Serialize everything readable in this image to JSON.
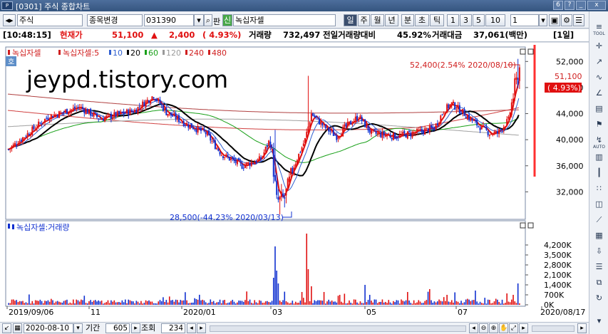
{
  "window": {
    "title": "[0301] 주식 종합차트",
    "btn_num": "6",
    "btn_q": "?",
    "btn_min": "_",
    "btn_close": "x"
  },
  "toolbar": {
    "market": "주식",
    "stock_change": "종목변경",
    "code": "031390",
    "pan": "판",
    "shin": "신",
    "stock_name": "녹십자셀",
    "period_buttons": [
      "일",
      "주",
      "월",
      "년",
      "분",
      "초",
      "틱"
    ],
    "active_period": "일",
    "interval_buttons": [
      "1",
      "3",
      "5",
      "10"
    ],
    "interval_value": "1"
  },
  "info": {
    "time": "[10:48:15]",
    "price_label": "현재가",
    "price": "51,100",
    "change_arrow": "▲",
    "change": "2,400",
    "change_pct": "( 4.93%)",
    "volume_label": "거래량",
    "volume": "732,497",
    "prev_ratio_label": "전일거래량대비",
    "prev_ratio": "45.92%",
    "amount_label": "거래대금",
    "amount": "37,061(백만)",
    "period": "[1일]"
  },
  "chart": {
    "legend_main": {
      "name": "녹십자셀",
      "ma_name": "녹십자셀:5",
      "ma": [
        {
          "label": "10",
          "color": "#2f5fd0"
        },
        {
          "label": "20",
          "color": "#000000"
        },
        {
          "label": "60",
          "color": "#18a018"
        },
        {
          "label": "120",
          "color": "#9a9a9a"
        },
        {
          "label": "240",
          "color": "#d02020"
        },
        {
          "label": "480",
          "color": "#d02020"
        }
      ]
    },
    "legend_volume": "녹십자셀:거래량",
    "watermark": "jeypd.tistory.com",
    "badge": "호",
    "annotations": {
      "high": "52,400(2.54% 2020/08/10)",
      "low": "28,500(-44.23% 2020/03/13)"
    },
    "price_axis": [
      "52,000",
      "48,000",
      "44,000",
      "40,000",
      "36,000",
      "32,000"
    ],
    "current_price_tag": {
      "price": "51,100",
      "pct": "( 4.93%)"
    },
    "volume_axis": [
      "4,200K",
      "3,500K",
      "2,800K",
      "2,100K",
      "1,400K",
      "700K",
      "0K"
    ],
    "date_axis": [
      "2019/09/06",
      "11",
      "2020/01",
      "03",
      "05",
      "07",
      "2020/08/17"
    ],
    "colors": {
      "up": "#e01010",
      "down": "#1030d0",
      "ma5": "#e01010",
      "ma20": "#000000",
      "ma60": "#18a018",
      "ma120": "#9a9a9a",
      "ma240": "#c83030"
    }
  },
  "bottombar": {
    "date": "2020-08-10",
    "period_label": "기간",
    "period_value": "605",
    "lookup_label": "조회",
    "count_value": "234"
  },
  "sidebar": {
    "items": [
      "TOOL",
      "추가",
      "도구",
      "저장",
      "인쇄",
      "설정",
      "AUTO"
    ]
  }
}
